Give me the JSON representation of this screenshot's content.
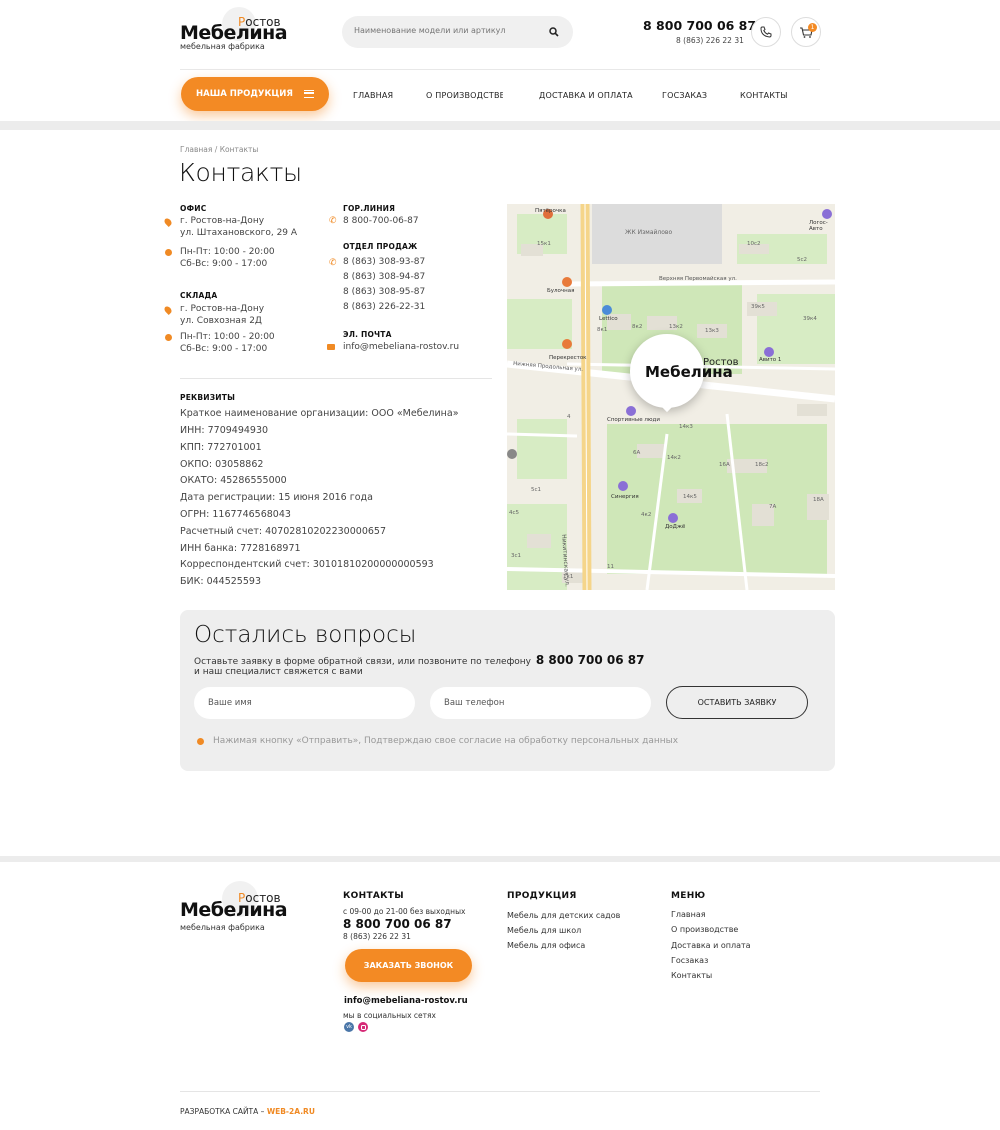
{
  "header": {
    "logo": {
      "name": "Мебелина",
      "city": "Ростов",
      "tagline": "мебельная фабрика"
    },
    "search": {
      "placeholder": "Наименование модели или артикул"
    },
    "phone_main": "8 800 700 06 87",
    "phone_local": "8 (863) 226 22 31",
    "cart_count": "1"
  },
  "nav": {
    "products_button": "НАША ПРОДУКЦИЯ",
    "items": [
      "ГЛАВНАЯ",
      "О ПРОИЗВОДСТВЕ",
      "ДОСТАВКА И ОПЛАТА",
      "ГОСЗАКАЗ",
      "КОНТАКТЫ"
    ]
  },
  "breadcrumb": "Главная / Контакты",
  "page_title": "Контакты",
  "office": {
    "title": "ОФИС",
    "address1": "г. Ростов-на-Дону",
    "address2": "ул. Штахановского, 29 А",
    "hours1": "Пн-Пт: 10:00 - 20:00",
    "hours2": "Сб-Вс: 9:00 - 17:00"
  },
  "warehouse": {
    "title": "СКЛАДА",
    "address1": "г. Ростов-на-Дону",
    "address2": "ул. Совхозная 2Д",
    "hours1": "Пн-Пт: 10:00 - 20:00",
    "hours2": "Сб-Вс: 9:00 - 17:00"
  },
  "hotline": {
    "title": "ГОР.ЛИНИЯ",
    "phone": "8 800-700-06-87"
  },
  "sales": {
    "title": "ОТДЕЛ ПРОДАЖ",
    "phones": [
      "8 (863) 308-93-87",
      "8 (863) 308-94-87",
      "8 (863) 308-95-87",
      "8 (863) 226-22-31"
    ]
  },
  "email": {
    "title": "ЭЛ. ПОЧТА",
    "value": "info@mebeliana-rostov.ru"
  },
  "requisites": {
    "title": "РЕКВИЗИТЫ",
    "lines": [
      "Краткое наименование организации: ООО «Мебелина»",
      "ИНН: 7709494930",
      "КПП: 772701001",
      "ОКПО: 03058862",
      "ОКАТО: 45286555000",
      "Дата регистрации: 15 июня 2016 года",
      "ОГРН: 1167746568043",
      "Расчетный счет: 40702810202230000657",
      "ИНН банка: 7728168971",
      "Корреспондентский счет: 30101810200000000593",
      "БИК: 044525593"
    ]
  },
  "map": {
    "marker_name": "Мебелина",
    "marker_city": "Ростов",
    "labels": [
      "Пятёрочка",
      "ЖК Измайлово",
      "Логос-Авто",
      "Верхняя Первомайская ул.",
      "Булочная",
      "Lettico",
      "Перекресток",
      "Авито 1",
      "Спортивные люди",
      "Синергия",
      "ДоДжё",
      "Никитинская ул.",
      "Нижняя Продольная ул.",
      "15к1",
      "10с2",
      "5с2",
      "8к1",
      "8к2",
      "13к2",
      "13к3",
      "39к5",
      "39к4",
      "4",
      "14к2",
      "14к3",
      "6А",
      "16А",
      "18с2",
      "14к5",
      "4к2",
      "7А",
      "18А",
      "5с1",
      "3с1",
      "1к1",
      "9",
      "11",
      "4с5"
    ]
  },
  "question": {
    "title": "Остались вопросы",
    "text1": "Оставьте заявку в форме обратной связи, или позвоните по телефону",
    "phone": "8 800 700 06 87",
    "text2": "и наш специалист свяжется с вами",
    "name_placeholder": "Ваше имя",
    "phone_placeholder": "Ваш телефон",
    "submit": "ОСТАВИТЬ ЗАЯВКУ",
    "consent": "Нажимая кнопку «Отправить», Подтверждаю свое согласие на обработку персональных данных"
  },
  "footer": {
    "contacts": {
      "title": "КОНТАКТЫ",
      "hours": "с 09-00 до 21-00 без выходных",
      "phone": "8 800 700 06 87",
      "phone2": "8 (863) 226 22 31",
      "callback": "ЗАКАЗАТЬ ЗВОНОК",
      "email": "info@mebeliana-rostov.ru",
      "social": "мы в социальных сетях"
    },
    "products": {
      "title": "ПРОДУКЦИЯ",
      "items": [
        "Мебель для детских садов",
        "Мебель для школ",
        "Мебель для офиса"
      ]
    },
    "menu": {
      "title": "МЕНЮ",
      "items": [
        "Главная",
        "О производстве",
        "Доставка и оплата",
        "Госзаказ",
        "Контакты"
      ]
    },
    "dev_label": "РАЗРАБОТКА САЙТА –",
    "dev_link": "WEB-2A.RU"
  }
}
